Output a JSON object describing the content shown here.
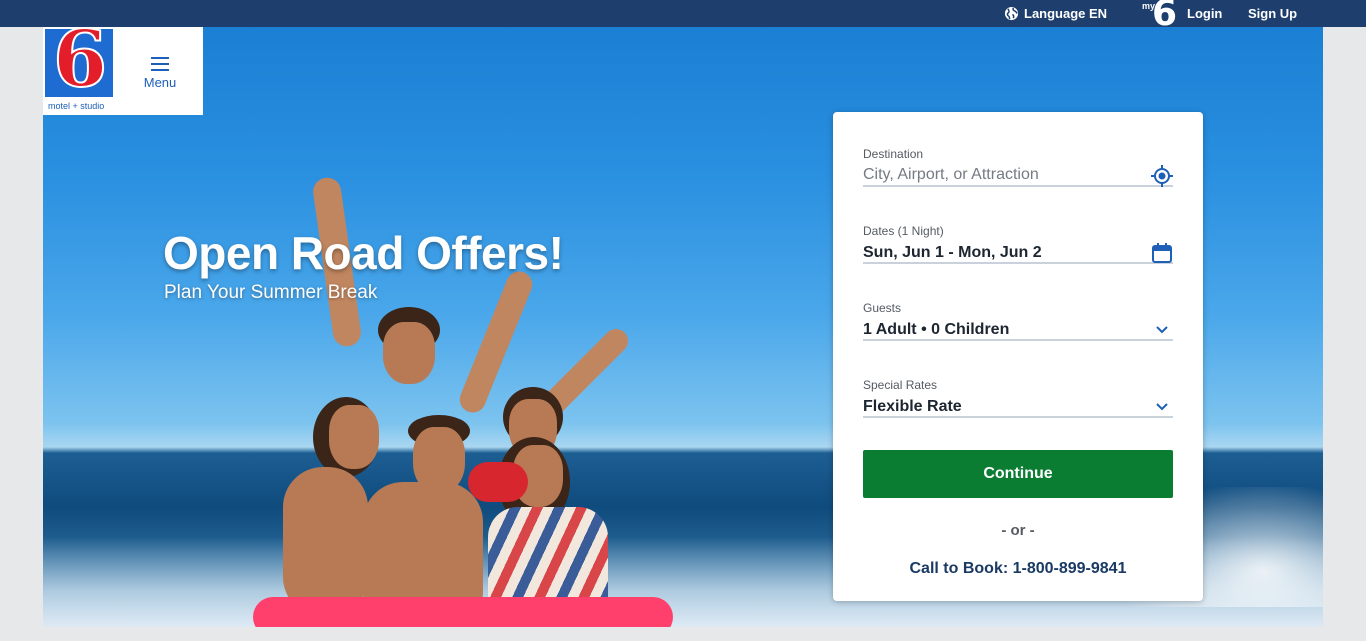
{
  "topbar": {
    "language": "Language EN",
    "my6_small": "my",
    "my6_big": "6",
    "login": "Login",
    "signup": "Sign Up",
    "icons": {
      "language": "globe-icon"
    }
  },
  "logo": {
    "mark": "6",
    "subtitle": "motel + studio"
  },
  "menu": {
    "label": "Menu",
    "icon": "hamburger-icon"
  },
  "hero": {
    "title": "Open Road Offers!",
    "subtitle": "Plan Your Summer Break"
  },
  "booking": {
    "destination": {
      "label": "Destination",
      "placeholder": "City, Airport, or Attraction",
      "value": "",
      "icon": "location-target-icon"
    },
    "dates": {
      "label": "Dates (1 Night)",
      "value": "Sun, Jun 1 - Mon, Jun 2",
      "icon": "calendar-icon"
    },
    "guests": {
      "label": "Guests",
      "value": "1 Adult • 0 Children",
      "icon": "chevron-down-icon"
    },
    "rates": {
      "label": "Special Rates",
      "value": "Flexible Rate",
      "icon": "chevron-down-icon"
    },
    "continue_label": "Continue",
    "or_text": "- or -",
    "call_text": "Call to Book: 1-800-899-9841"
  },
  "colors": {
    "topbar": "#1e3f6e",
    "brand_blue": "#1e6bd1",
    "brand_red": "#e41d2a",
    "continue_green": "#0a7d32",
    "accent_blue": "#1e5fb8"
  }
}
